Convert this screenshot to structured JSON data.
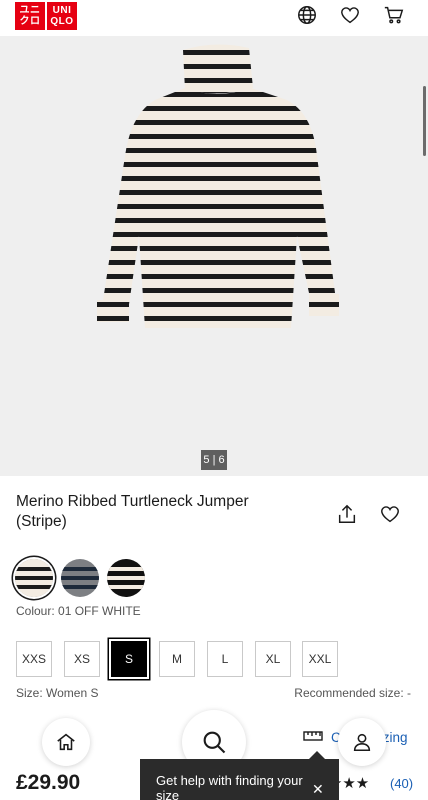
{
  "header": {
    "logo_line1": "ユニクロ",
    "logo_line2": "UNI QLO",
    "icons": [
      "globe-icon",
      "heart-icon",
      "cart-icon"
    ]
  },
  "gallery": {
    "counter": "5 | 6"
  },
  "product": {
    "title": "Merino Ribbed Turtleneck Jumper (Stripe)",
    "colour_label": "Colour: 01 OFF WHITE",
    "colours": [
      {
        "name": "off-white",
        "base": "#f3ece2",
        "stripe": "#1b1b1b"
      },
      {
        "name": "grey",
        "base": "#7d7f83",
        "stripe": "#1e2a3a"
      },
      {
        "name": "black",
        "base": "#111111",
        "stripe": "#f3ece2"
      }
    ],
    "sizes": [
      "XXS",
      "XS",
      "S",
      "M",
      "L",
      "XL",
      "XXL"
    ],
    "selected_size": "S",
    "size_label": "Size: Women S",
    "recommended_size": "Recommended size: -",
    "sizing_link": "Check sizing",
    "price": "£29.90",
    "stars": "★★★★★",
    "review_count": "(40)"
  },
  "help_popup": {
    "text": "Get help with finding your size",
    "close": "✕"
  },
  "colors": {
    "brand": "#e60012",
    "link": "#1a5fb4"
  }
}
